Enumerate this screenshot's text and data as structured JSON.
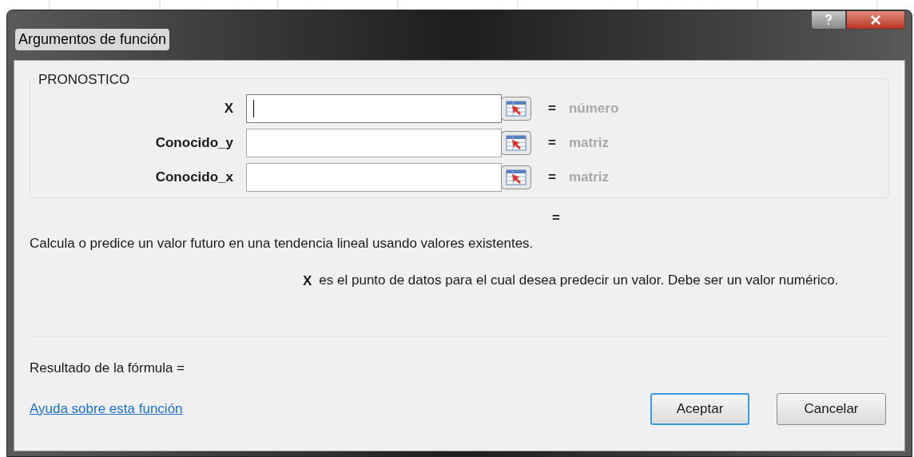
{
  "window": {
    "title": "Argumentos de función"
  },
  "group": {
    "title": "PRONOSTICO",
    "arguments": [
      {
        "label": "X",
        "focused": true,
        "equals": "=",
        "result": "número"
      },
      {
        "label": "Conocido_y",
        "focused": false,
        "equals": "=",
        "result": "matriz"
      },
      {
        "label": "Conocido_x",
        "focused": false,
        "equals": "=",
        "result": "matriz"
      }
    ]
  },
  "function_result": {
    "equals": "="
  },
  "description": "Calcula o predice un valor futuro en una tendencia lineal usando valores existentes.",
  "argument_help": {
    "name": "X",
    "text": "es el punto de datos para el cual desea predecir un valor. Debe ser un valor numérico."
  },
  "formula_result": "Resultado de la fórmula =",
  "help_link": "Ayuda sobre esta función",
  "buttons": [
    {
      "label": "Aceptar",
      "default": true
    },
    {
      "label": "Cancelar",
      "default": false
    }
  ]
}
